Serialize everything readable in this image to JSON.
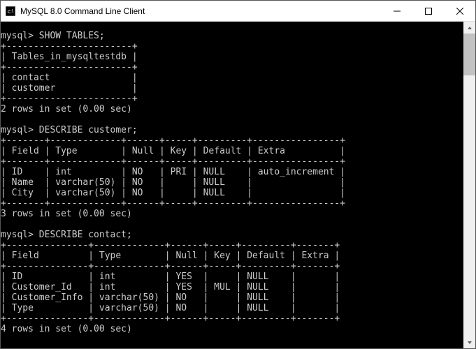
{
  "window": {
    "title": "MySQL 8.0 Command Line Client"
  },
  "terminal": {
    "prompt": "mysql>",
    "commands": {
      "showTables": "SHOW TABLES;",
      "describeCustomer": "DESCRIBE customer;",
      "describeContact": "DESCRIBE contact;"
    },
    "showTables": {
      "header": "Tables_in_mysqltestdb",
      "rows": [
        "contact",
        "customer"
      ],
      "status": "2 rows in set (0.00 sec)"
    },
    "describeCustomer": {
      "columns": [
        "Field",
        "Type",
        "Null",
        "Key",
        "Default",
        "Extra"
      ],
      "rows": [
        {
          "Field": "ID",
          "Type": "int",
          "Null": "NO",
          "Key": "PRI",
          "Default": "NULL",
          "Extra": "auto_increment"
        },
        {
          "Field": "Name",
          "Type": "varchar(50)",
          "Null": "NO",
          "Key": "",
          "Default": "NULL",
          "Extra": ""
        },
        {
          "Field": "City",
          "Type": "varchar(50)",
          "Null": "NO",
          "Key": "",
          "Default": "NULL",
          "Extra": ""
        }
      ],
      "status": "3 rows in set (0.00 sec)"
    },
    "describeContact": {
      "columns": [
        "Field",
        "Type",
        "Null",
        "Key",
        "Default",
        "Extra"
      ],
      "rows": [
        {
          "Field": "ID",
          "Type": "int",
          "Null": "YES",
          "Key": "",
          "Default": "NULL",
          "Extra": ""
        },
        {
          "Field": "Customer_Id",
          "Type": "int",
          "Null": "YES",
          "Key": "MUL",
          "Default": "NULL",
          "Extra": ""
        },
        {
          "Field": "Customer_Info",
          "Type": "varchar(50)",
          "Null": "NO",
          "Key": "",
          "Default": "NULL",
          "Extra": ""
        },
        {
          "Field": "Type",
          "Type": "varchar(50)",
          "Null": "NO",
          "Key": "",
          "Default": "NULL",
          "Extra": ""
        }
      ],
      "status": "4 rows in set (0.00 sec)"
    }
  }
}
